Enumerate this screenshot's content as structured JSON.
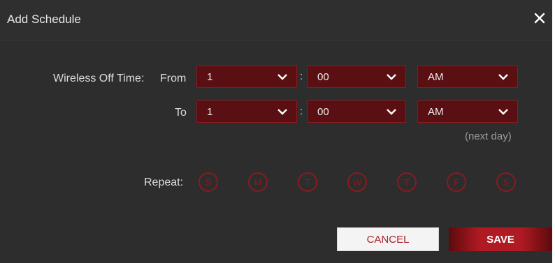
{
  "dialog": {
    "title": "Add Schedule",
    "close_icon": "close-icon"
  },
  "form": {
    "wireless_off_label": "Wireless Off Time:",
    "from_label": "From",
    "to_label": "To",
    "from": {
      "hour": "1",
      "minute": "00",
      "period": "AM"
    },
    "to": {
      "hour": "1",
      "minute": "00",
      "period": "AM"
    },
    "colon": ":",
    "next_day": "(next day)",
    "repeat_label": "Repeat:",
    "days": [
      "S",
      "M",
      "T",
      "W",
      "T",
      "F",
      "S"
    ]
  },
  "buttons": {
    "cancel": "CANCEL",
    "save": "SAVE"
  },
  "colors": {
    "accent": "#8a1a1f",
    "select_bg": "#5a0f12",
    "dialog_bg": "#2d2d2d"
  }
}
